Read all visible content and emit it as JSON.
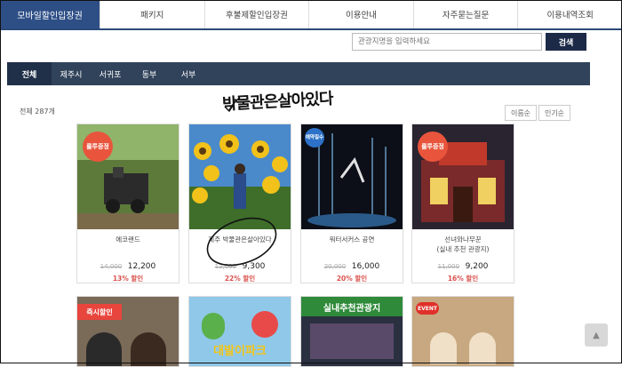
{
  "topnav": {
    "brand": "모바일할인입장권",
    "items": [
      "패키지",
      "후불제할인입장권",
      "이용안내",
      "자주묻는질문",
      "이용내역조회"
    ]
  },
  "search": {
    "placeholder": "관광지명을 입력하세요",
    "button": "검색"
  },
  "tabs": [
    "전체",
    "제주시",
    "서귀포",
    "동부",
    "서부"
  ],
  "count": "전체 287개",
  "sort": [
    "이름순",
    "인기순"
  ],
  "annotation": "박물관은살아있다",
  "products": [
    {
      "name": "에코랜드",
      "old_price": "14,000",
      "price": "12,200",
      "discount": "13% 할인",
      "badge": "룰루증정"
    },
    {
      "name": "제주 박물관은살아있다",
      "old_price": "12,000",
      "price": "9,300",
      "discount": "22% 할인"
    },
    {
      "name": "워터서커스 공연",
      "old_price": "20,000",
      "price": "16,000",
      "discount": "20% 할인",
      "badge": "예약필수"
    },
    {
      "name": "선녀와나무꾼\n(실내 추천 관광지)",
      "old_price": "11,000",
      "price": "9,200",
      "discount": "16% 할인",
      "badge": "룰루증정"
    }
  ],
  "row2": [
    {
      "label": "즉시할인"
    },
    {
      "label": "대발이파크"
    },
    {
      "label": "실내추천관광지"
    },
    {
      "label": "EVENT"
    }
  ],
  "colors": {
    "brand": "#2e4f86",
    "tabbar": "#31435a",
    "discount": "#d9534f"
  }
}
